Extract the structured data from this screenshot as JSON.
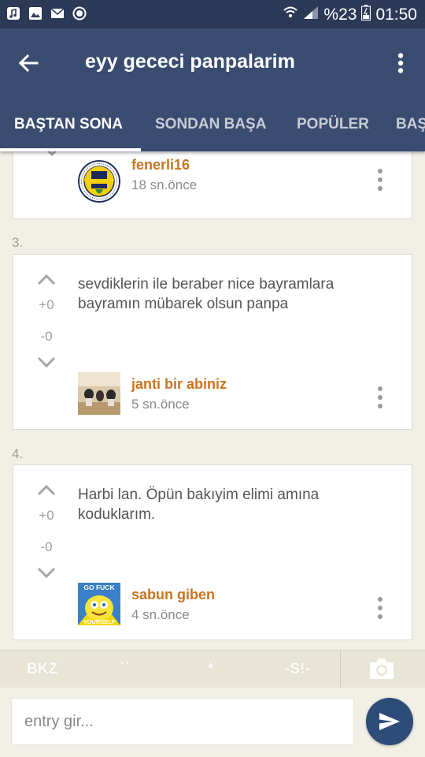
{
  "status_bar": {
    "battery": "%23",
    "time": "01:50",
    "icons": [
      "music-icon",
      "image-icon",
      "mail-icon",
      "record-icon",
      "wifi-icon",
      "signal-icon",
      "battery-icon"
    ]
  },
  "app_bar": {
    "title": "eyy gececi panpalarim",
    "tabs": [
      {
        "label": "BAŞTAN SONA",
        "active": true
      },
      {
        "label": "SONDAN BAŞA",
        "active": false
      },
      {
        "label": "POPÜLER",
        "active": false
      },
      {
        "label": "BAŞ",
        "active": false
      }
    ]
  },
  "entries": [
    {
      "number": "",
      "author": "fenerli16",
      "time": "18 sn.önce"
    },
    {
      "number": "3.",
      "text": "sevdiklerin ile beraber nice bayramlara bayramın mübarek olsun panpa",
      "upvotes": "+0",
      "downvotes": "-0",
      "author": "janti bir abiniz",
      "time": "5 sn.önce"
    },
    {
      "number": "4.",
      "text": "Harbi lan. Öpün bakıyim elimi amına koduklarım.",
      "upvotes": "+0",
      "downvotes": "-0",
      "author": "sabun giben",
      "time": "4 sn.önce",
      "avatar_text_top": "GO FUCK",
      "avatar_text_bottom": "YOURSELF"
    }
  ],
  "toolbar": {
    "bkz": "BKZ",
    "backtick": "``",
    "star": "*",
    "spoiler": "-S!-"
  },
  "input": {
    "placeholder": "entry gir..."
  },
  "colors": {
    "status_bar": "#2c3957",
    "app_bar": "#3a4c6f",
    "author": "#c8741f",
    "background": "#f2f0e6",
    "send_button": "#2e4c78"
  }
}
